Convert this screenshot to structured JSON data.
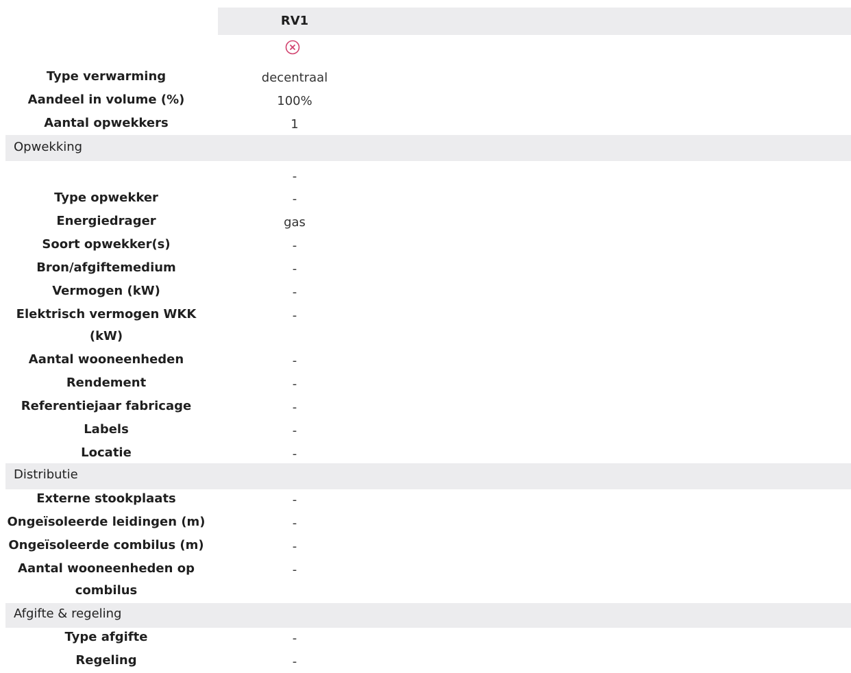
{
  "header": {
    "column_title": "RV1",
    "remove_icon": "close-circle-icon",
    "remove_icon_color": "#d1426e"
  },
  "general": {
    "rows": [
      {
        "label": "Type verwarming",
        "value": "decentraal"
      },
      {
        "label": "Aandeel in volume (%)",
        "value": "100%"
      },
      {
        "label": "Aantal opwekkers",
        "value": "1"
      }
    ]
  },
  "opwekking": {
    "title": "Opwekking",
    "top_value": "-",
    "rows": [
      {
        "label": "Type opwekker",
        "value": "-"
      },
      {
        "label": "Energiedrager",
        "value": "gas"
      },
      {
        "label": "Soort opwekker(s)",
        "value": "-"
      },
      {
        "label": "Bron/afgiftemedium",
        "value": "-"
      },
      {
        "label": "Vermogen (kW)",
        "value": "-"
      },
      {
        "label": "Elektrisch vermogen WKK (kW)",
        "value": "-"
      },
      {
        "label": "Aantal wooneenheden",
        "value": "-"
      },
      {
        "label": "Rendement",
        "value": "-"
      },
      {
        "label": "Referentiejaar fabricage",
        "value": "-"
      },
      {
        "label": "Labels",
        "value": "-"
      },
      {
        "label": "Locatie",
        "value": "-"
      }
    ]
  },
  "distributie": {
    "title": "Distributie",
    "rows": [
      {
        "label": "Externe stookplaats",
        "value": "-"
      },
      {
        "label": "Ongeïsoleerde leidingen (m)",
        "value": "-"
      },
      {
        "label": "Ongeïsoleerde combilus (m)",
        "value": "-"
      },
      {
        "label": "Aantal wooneenheden op combilus",
        "value": "-"
      }
    ]
  },
  "afgifte": {
    "title": "Afgifte & regeling",
    "rows": [
      {
        "label": "Type afgifte",
        "value": "-"
      },
      {
        "label": "Regeling",
        "value": "-"
      }
    ]
  }
}
